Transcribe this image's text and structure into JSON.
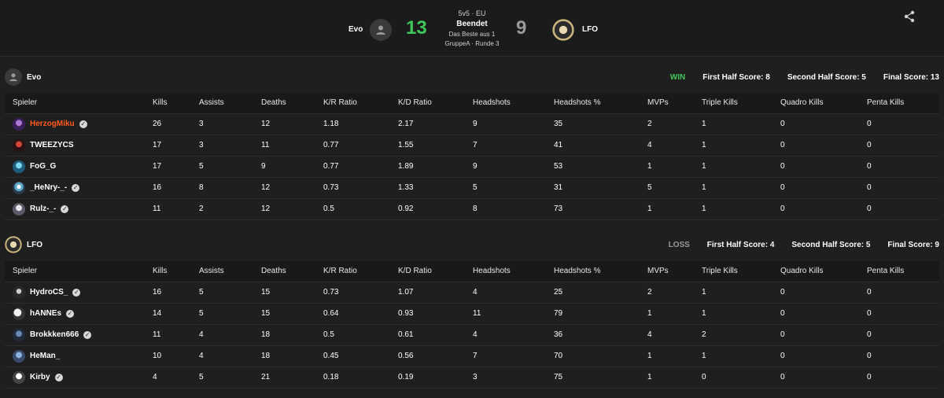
{
  "header": {
    "left_team": "Evo",
    "left_score": "13",
    "right_team": "LFO",
    "right_score": "9",
    "mode": "5v5 · EU",
    "status": "Beendet",
    "best_of": "Das Beste aus 1",
    "round_info": "GruppeA · Runde 3",
    "colors": {
      "win": "#3fc55a",
      "loss": "#9a9a9a",
      "highlight": "#ff5a1f"
    }
  },
  "columns": [
    "Spieler",
    "Kills",
    "Assists",
    "Deaths",
    "K/R Ratio",
    "K/D Ratio",
    "Headshots",
    "Headshots %",
    "MVPs",
    "Triple Kills",
    "Quadro Kills",
    "Penta Kills"
  ],
  "teams": [
    {
      "name": "Evo",
      "result": "WIN",
      "first_half": "First Half Score: 8",
      "second_half": "Second Half Score: 5",
      "final": "Final Score: 13",
      "players": [
        {
          "name": "HerzogMiku",
          "verified": true,
          "highlight": true,
          "stats": [
            "26",
            "3",
            "12",
            "1.18",
            "2.17",
            "9",
            "35",
            "2",
            "1",
            "0",
            "0"
          ]
        },
        {
          "name": "TWEEZYCS",
          "verified": false,
          "highlight": false,
          "stats": [
            "17",
            "3",
            "11",
            "0.77",
            "1.55",
            "7",
            "41",
            "4",
            "1",
            "0",
            "0"
          ]
        },
        {
          "name": "FoG_G",
          "verified": false,
          "highlight": false,
          "stats": [
            "17",
            "5",
            "9",
            "0.77",
            "1.89",
            "9",
            "53",
            "1",
            "1",
            "0",
            "0"
          ]
        },
        {
          "name": "_HeNry-_-",
          "verified": true,
          "highlight": false,
          "stats": [
            "16",
            "8",
            "12",
            "0.73",
            "1.33",
            "5",
            "31",
            "5",
            "1",
            "0",
            "0"
          ]
        },
        {
          "name": "Rulz-_-",
          "verified": true,
          "highlight": false,
          "stats": [
            "11",
            "2",
            "12",
            "0.5",
            "0.92",
            "8",
            "73",
            "1",
            "1",
            "0",
            "0"
          ]
        }
      ]
    },
    {
      "name": "LFO",
      "result": "LOSS",
      "first_half": "First Half Score: 4",
      "second_half": "Second Half Score: 5",
      "final": "Final Score: 9",
      "players": [
        {
          "name": "HydroCS_",
          "verified": true,
          "highlight": false,
          "stats": [
            "16",
            "5",
            "15",
            "0.73",
            "1.07",
            "4",
            "25",
            "2",
            "1",
            "0",
            "0"
          ]
        },
        {
          "name": "hANNEs",
          "verified": true,
          "highlight": false,
          "stats": [
            "14",
            "5",
            "15",
            "0.64",
            "0.93",
            "11",
            "79",
            "1",
            "1",
            "0",
            "0"
          ]
        },
        {
          "name": "Brokkken666",
          "verified": true,
          "highlight": false,
          "stats": [
            "11",
            "4",
            "18",
            "0.5",
            "0.61",
            "4",
            "36",
            "4",
            "2",
            "0",
            "0"
          ]
        },
        {
          "name": "HeMan_",
          "verified": false,
          "highlight": false,
          "stats": [
            "10",
            "4",
            "18",
            "0.45",
            "0.56",
            "7",
            "70",
            "1",
            "1",
            "0",
            "0"
          ]
        },
        {
          "name": "Kirby",
          "verified": true,
          "highlight": false,
          "stats": [
            "4",
            "5",
            "21",
            "0.18",
            "0.19",
            "3",
            "75",
            "1",
            "0",
            "0",
            "0"
          ]
        }
      ]
    }
  ]
}
